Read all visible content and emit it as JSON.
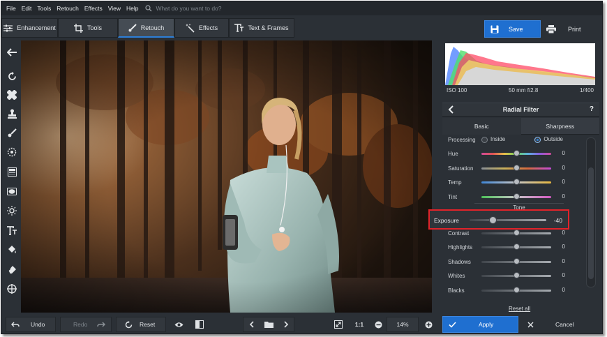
{
  "menu": [
    "File",
    "Edit",
    "Tools",
    "Retouch",
    "Effects",
    "View",
    "Help"
  ],
  "search": {
    "placeholder": "What do you want to do?"
  },
  "tabs": [
    {
      "label": "Enhancement",
      "icon": "sliders-icon"
    },
    {
      "label": "Tools",
      "icon": "crop-icon"
    },
    {
      "label": "Retouch",
      "icon": "brush-icon",
      "active": true
    },
    {
      "label": "Effects",
      "icon": "magic-wand-icon"
    },
    {
      "label": "Text & Frames",
      "icon": "text-icon"
    }
  ],
  "toolbar": {
    "save_label": "Save",
    "print_label": "Print"
  },
  "left_tools": [
    "back-arrow-icon",
    "rotate-icon",
    "healing-patch-icon",
    "clone-stamp-icon",
    "brush-icon",
    "spot-icon",
    "gradient-filter-icon",
    "radial-filter-icon",
    "sun-icon",
    "text-icon",
    "paint-bucket-icon",
    "eraser-icon",
    "target-icon"
  ],
  "camera_info": {
    "iso": "ISO 100",
    "lens": "50 mm f/2.8",
    "shutter": "1/400"
  },
  "panel": {
    "title": "Radial Filter",
    "help": "?",
    "tabs": [
      "Basic",
      "Sharpness"
    ],
    "processing": {
      "label": "Processing",
      "options": [
        "Inside",
        "Outside"
      ],
      "selected": "Outside"
    },
    "color_sliders": [
      {
        "label": "Hue",
        "value": "0",
        "style": "hue"
      },
      {
        "label": "Saturation",
        "value": "0",
        "style": "sat"
      },
      {
        "label": "Temp",
        "value": "0",
        "style": "temp"
      },
      {
        "label": "Tint",
        "value": "0",
        "style": "tint"
      }
    ],
    "tone_label": "Tone",
    "exposure": {
      "label": "Exposure",
      "value": "-40",
      "level": -40
    },
    "tone_sliders": [
      {
        "label": "Contrast",
        "value": "0"
      },
      {
        "label": "Highlights",
        "value": "0"
      },
      {
        "label": "Shadows",
        "value": "0"
      },
      {
        "label": "Whites",
        "value": "0"
      },
      {
        "label": "Blacks",
        "value": "0"
      }
    ],
    "reset_all": "Reset all"
  },
  "bottom": {
    "undo": "Undo",
    "redo": "Redo",
    "reset": "Reset",
    "zoom_actual": "1:1",
    "zoom_level": "14%",
    "apply": "Apply",
    "cancel": "Cancel"
  },
  "colors": {
    "accent": "#1f6fd0",
    "highlight_box": "#e2232a",
    "panel_bg": "#2b3036"
  }
}
